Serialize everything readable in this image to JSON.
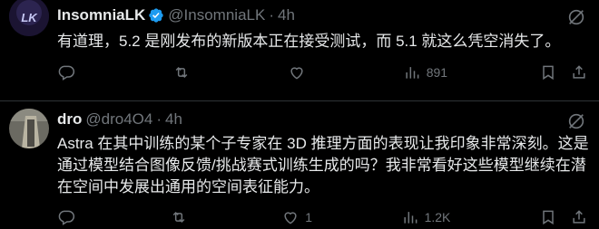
{
  "posts": [
    {
      "name": "InsomniaLK",
      "handle": "@InsomniaLK",
      "separator": "·",
      "time": "4h",
      "verified": true,
      "text": "有道理，5.2 是刚发布的新版本正在接受测试，而 5.1 就这么凭空消失了。",
      "actions": {
        "replies": "",
        "reposts": "",
        "likes": "",
        "views": "891"
      }
    },
    {
      "name": "dro",
      "handle": "@dro4O4",
      "separator": "·",
      "time": "4h",
      "verified": false,
      "text": "Astra 在其中训练的某个子专家在 3D 推理方面的表现让我印象非常深刻。这是通过模型结合图像反馈/挑战赛式训练生成的吗？我非常看好这些模型继续在潜在空间中发展出通用的空间表征能力。",
      "actions": {
        "replies": "",
        "reposts": "",
        "likes": "1",
        "views": "1.2K"
      }
    }
  ],
  "colors": {
    "background": "#000000",
    "text": "#e7e9ea",
    "muted": "#71767b",
    "verified": "#1d9bf0",
    "divider": "#2f3336"
  },
  "icons": [
    "verified-badge-icon",
    "grok-icon",
    "reply-icon",
    "repost-icon",
    "like-icon",
    "views-icon",
    "bookmark-icon",
    "share-icon"
  ]
}
